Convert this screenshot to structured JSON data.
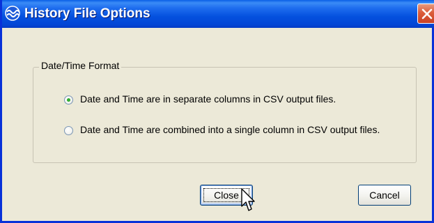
{
  "window": {
    "title": "History File Options",
    "app_icon": "wave-icon",
    "close_icon": "close-x-icon"
  },
  "group": {
    "label": "Date/Time Format",
    "options": [
      {
        "label": "Date and Time are in separate columns in CSV output files.",
        "selected": true
      },
      {
        "label": "Date and Time are combined into a single column in CSV output files.",
        "selected": false
      }
    ]
  },
  "buttons": {
    "close_label": "Close",
    "cancel_label": "Cancel"
  },
  "colors": {
    "titlebar": "#0450DE",
    "dialog_bg": "#ECE9D8",
    "close_button": "#DC5C3A",
    "radio_selected": "#21A121"
  }
}
